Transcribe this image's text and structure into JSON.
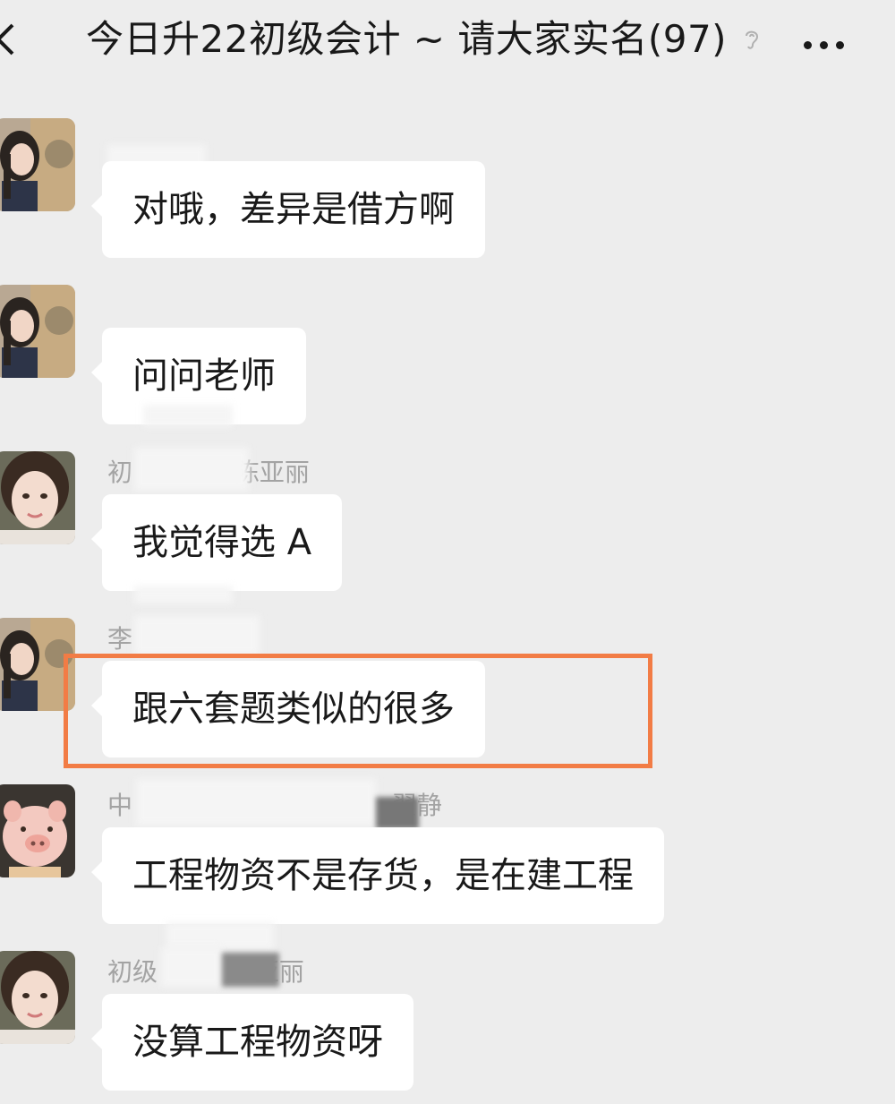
{
  "header": {
    "back_icon": "chevron-left-icon",
    "title": "今日升22初级会计 ~ 请大家实名(97)",
    "ear_icon": "ear-icon",
    "more_icon": "more-dots-icon"
  },
  "messages": [
    {
      "sender": "",
      "text": "对哦，差异是借方啊",
      "avatar": "girl-dark-hair-avatar"
    },
    {
      "sender": "",
      "text": "问问老师",
      "avatar": "girl-dark-hair-avatar"
    },
    {
      "sender_prefix": "初",
      "sender_suffix": "陈亚丽",
      "text": "我觉得选 A",
      "avatar": "girl-selfie-avatar"
    },
    {
      "sender_prefix": "李",
      "sender_suffix": "",
      "text": "跟六套题类似的很多",
      "avatar": "girl-dark-hair-avatar",
      "highlighted": true
    },
    {
      "sender_prefix": "中",
      "sender_suffix": "翟静",
      "text": "工程物资不是存货，是在建工程",
      "avatar": "pig-avatar"
    },
    {
      "sender_prefix": "初级",
      "sender_suffix": "亚丽",
      "text": "没算工程物资呀",
      "avatar": "girl-selfie-avatar"
    }
  ],
  "colors": {
    "background": "#ededed",
    "bubble": "#ffffff",
    "highlight": "#f27c45",
    "sender_text": "#a3a3a3"
  }
}
